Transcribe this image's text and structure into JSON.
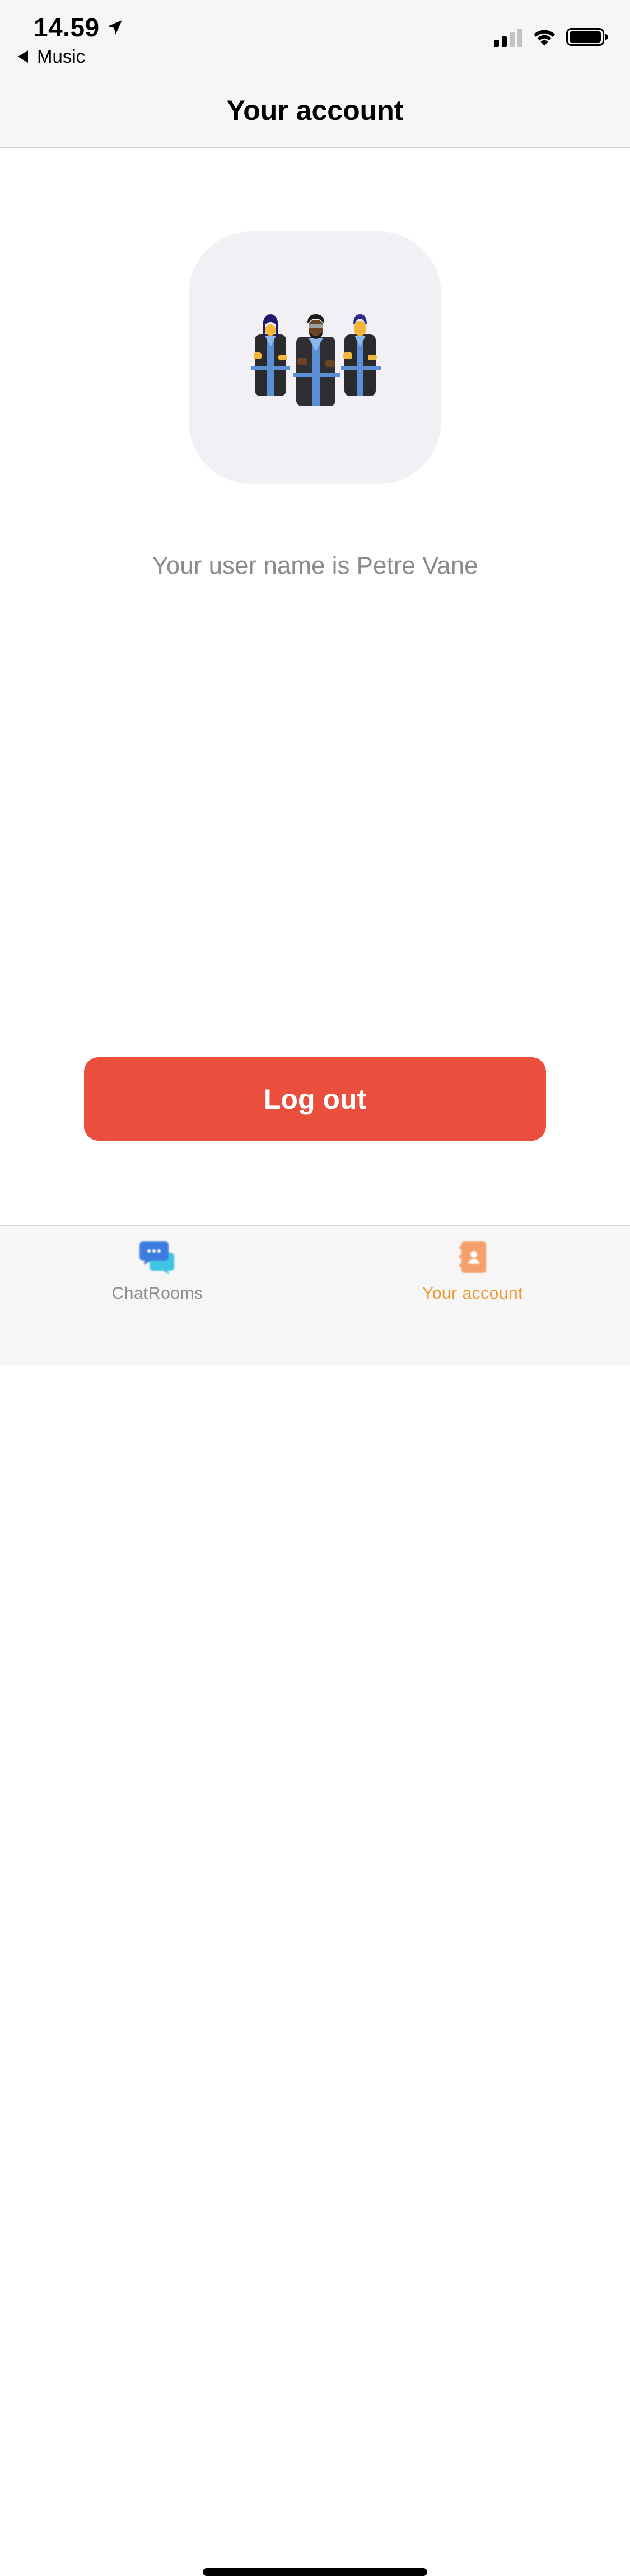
{
  "status_bar": {
    "time": "14.59",
    "back_app": "Music",
    "icons": [
      "location-arrow-icon",
      "signal-icon",
      "wifi-icon",
      "battery-icon"
    ]
  },
  "nav": {
    "title": "Your account"
  },
  "profile": {
    "avatar_icon": "team-illustration",
    "username_text": "Your user name is Petre Vane"
  },
  "actions": {
    "logout_label": "Log out"
  },
  "tabs": [
    {
      "label": "ChatRooms",
      "icon": "chat-bubbles-icon",
      "active": false
    },
    {
      "label": "Your account",
      "icon": "contact-card-icon",
      "active": true
    }
  ],
  "colors": {
    "logout_bg": "#ea4f3d",
    "tab_active": "#f0962e",
    "tab_inactive": "#8e8e93",
    "avatar_card_bg": "#f1f1f5",
    "secondary_text": "#8a8a8f"
  }
}
